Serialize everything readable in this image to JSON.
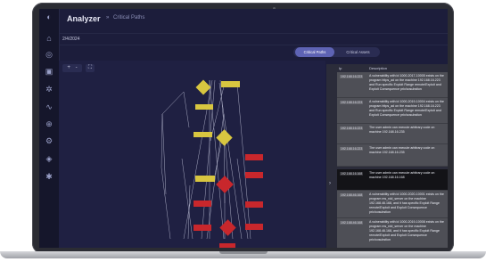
{
  "header": {
    "app_title": "Analyzer",
    "separator": "»",
    "breadcrumb": "Critical Paths",
    "date": "2/4/2024"
  },
  "tabs": [
    {
      "label": "Critical Paths",
      "active": true
    },
    {
      "label": "Critical Assets",
      "active": false
    }
  ],
  "graph_controls": {
    "zoom_in": "+",
    "zoom_out": "-",
    "fit": "⛶"
  },
  "table": {
    "columns": [
      "Ip",
      "Description"
    ],
    "rows": [
      {
        "ip": "192.168.16.223",
        "desc": "A vulnerability with id 1000-2017-10005 exists on the program https_ad on the machine 192.168.16.223 and Run specific Exploit Range remote/Exploit and Exploit Consequence priv/cosubstion",
        "selected": false
      },
      {
        "ip": "192.168.16.223",
        "desc": "A vulnerability with id 1000-2019-10004 exists on the program https_ad on the machine 192.168.16.223 and Run specific Exploit Range remote/Exploit and Exploit Consequence priv/cosubstion",
        "selected": false
      },
      {
        "ip": "192.168.16.223",
        "desc": "The user admin can execute arbitrary code on machine 192.168.16.235",
        "selected": false
      },
      {
        "ip": "192.168.16.223",
        "desc": "The user admin can execute arbitrary code on machine 192.168.16.235",
        "selected": false
      },
      {
        "ip": "192.168.16.168",
        "desc": "The user admin can execute arbitrary code on machine 192.168.16.168",
        "selected": true
      },
      {
        "ip": "192.168.46.168",
        "desc": "A vulnerability with id 1000-2020-10001 exists on the program ms_rdd_server on the machine 192.168.46.168, and it has specific Exploit Range remote/Exploit and Exploit Consequence priv/cosubstion",
        "selected": false
      },
      {
        "ip": "192.168.46.168",
        "desc": "A vulnerability with id 1000-2019-10008 exists on the program ms_rdd_server on the machine 192.168.46.168, and it has specific Exploit Range remote/Exploit and Exploit Consequence priv/cosubstion",
        "selected": false
      }
    ]
  },
  "icons": [
    "logo-icon",
    "home-icon",
    "target-icon",
    "monitor-icon",
    "settings-icon",
    "chart-icon",
    "network-icon",
    "gear-icon",
    "shield-icon",
    "config-icon"
  ]
}
